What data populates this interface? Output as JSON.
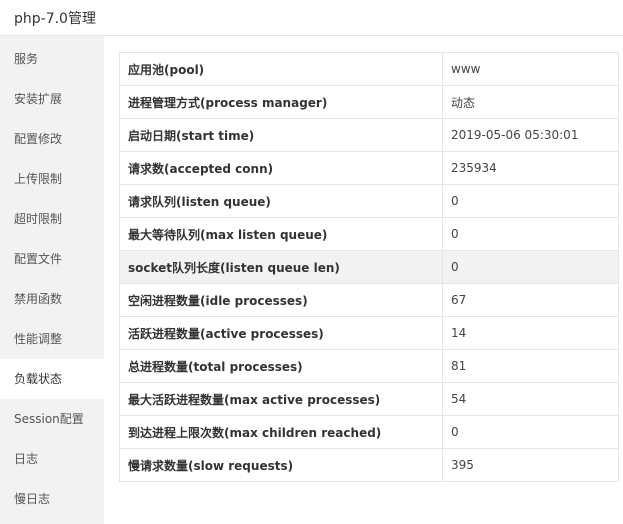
{
  "window": {
    "title": "php-7.0管理"
  },
  "sidebar": {
    "items": [
      {
        "label": "服务"
      },
      {
        "label": "安装扩展"
      },
      {
        "label": "配置修改"
      },
      {
        "label": "上传限制"
      },
      {
        "label": "超时限制"
      },
      {
        "label": "配置文件"
      },
      {
        "label": "禁用函数"
      },
      {
        "label": "性能调整"
      },
      {
        "label": "负载状态"
      },
      {
        "label": "Session配置"
      },
      {
        "label": "日志"
      },
      {
        "label": "慢日志"
      }
    ],
    "active_index": 8
  },
  "status_table": {
    "highlighted_row_index": 6,
    "rows": [
      {
        "key": "应用池(pool)",
        "value": "www"
      },
      {
        "key": "进程管理方式(process manager)",
        "value": "动态"
      },
      {
        "key": "启动日期(start time)",
        "value": "2019-05-06 05:30:01"
      },
      {
        "key": "请求数(accepted conn)",
        "value": "235934"
      },
      {
        "key": "请求队列(listen queue)",
        "value": "0"
      },
      {
        "key": "最大等待队列(max listen queue)",
        "value": "0"
      },
      {
        "key": "socket队列长度(listen queue len)",
        "value": "0"
      },
      {
        "key": "空闲进程数量(idle processes)",
        "value": "67"
      },
      {
        "key": "活跃进程数量(active processes)",
        "value": "14"
      },
      {
        "key": "总进程数量(total processes)",
        "value": "81"
      },
      {
        "key": "最大活跃进程数量(max active processes)",
        "value": "54"
      },
      {
        "key": "到达进程上限次数(max children reached)",
        "value": "0"
      },
      {
        "key": "慢请求数量(slow requests)",
        "value": "395"
      }
    ]
  },
  "colors": {
    "sidebar_bg": "#f2f2f2",
    "border": "#e6e6e6",
    "highlight_row_bg": "#f2f2f2"
  }
}
